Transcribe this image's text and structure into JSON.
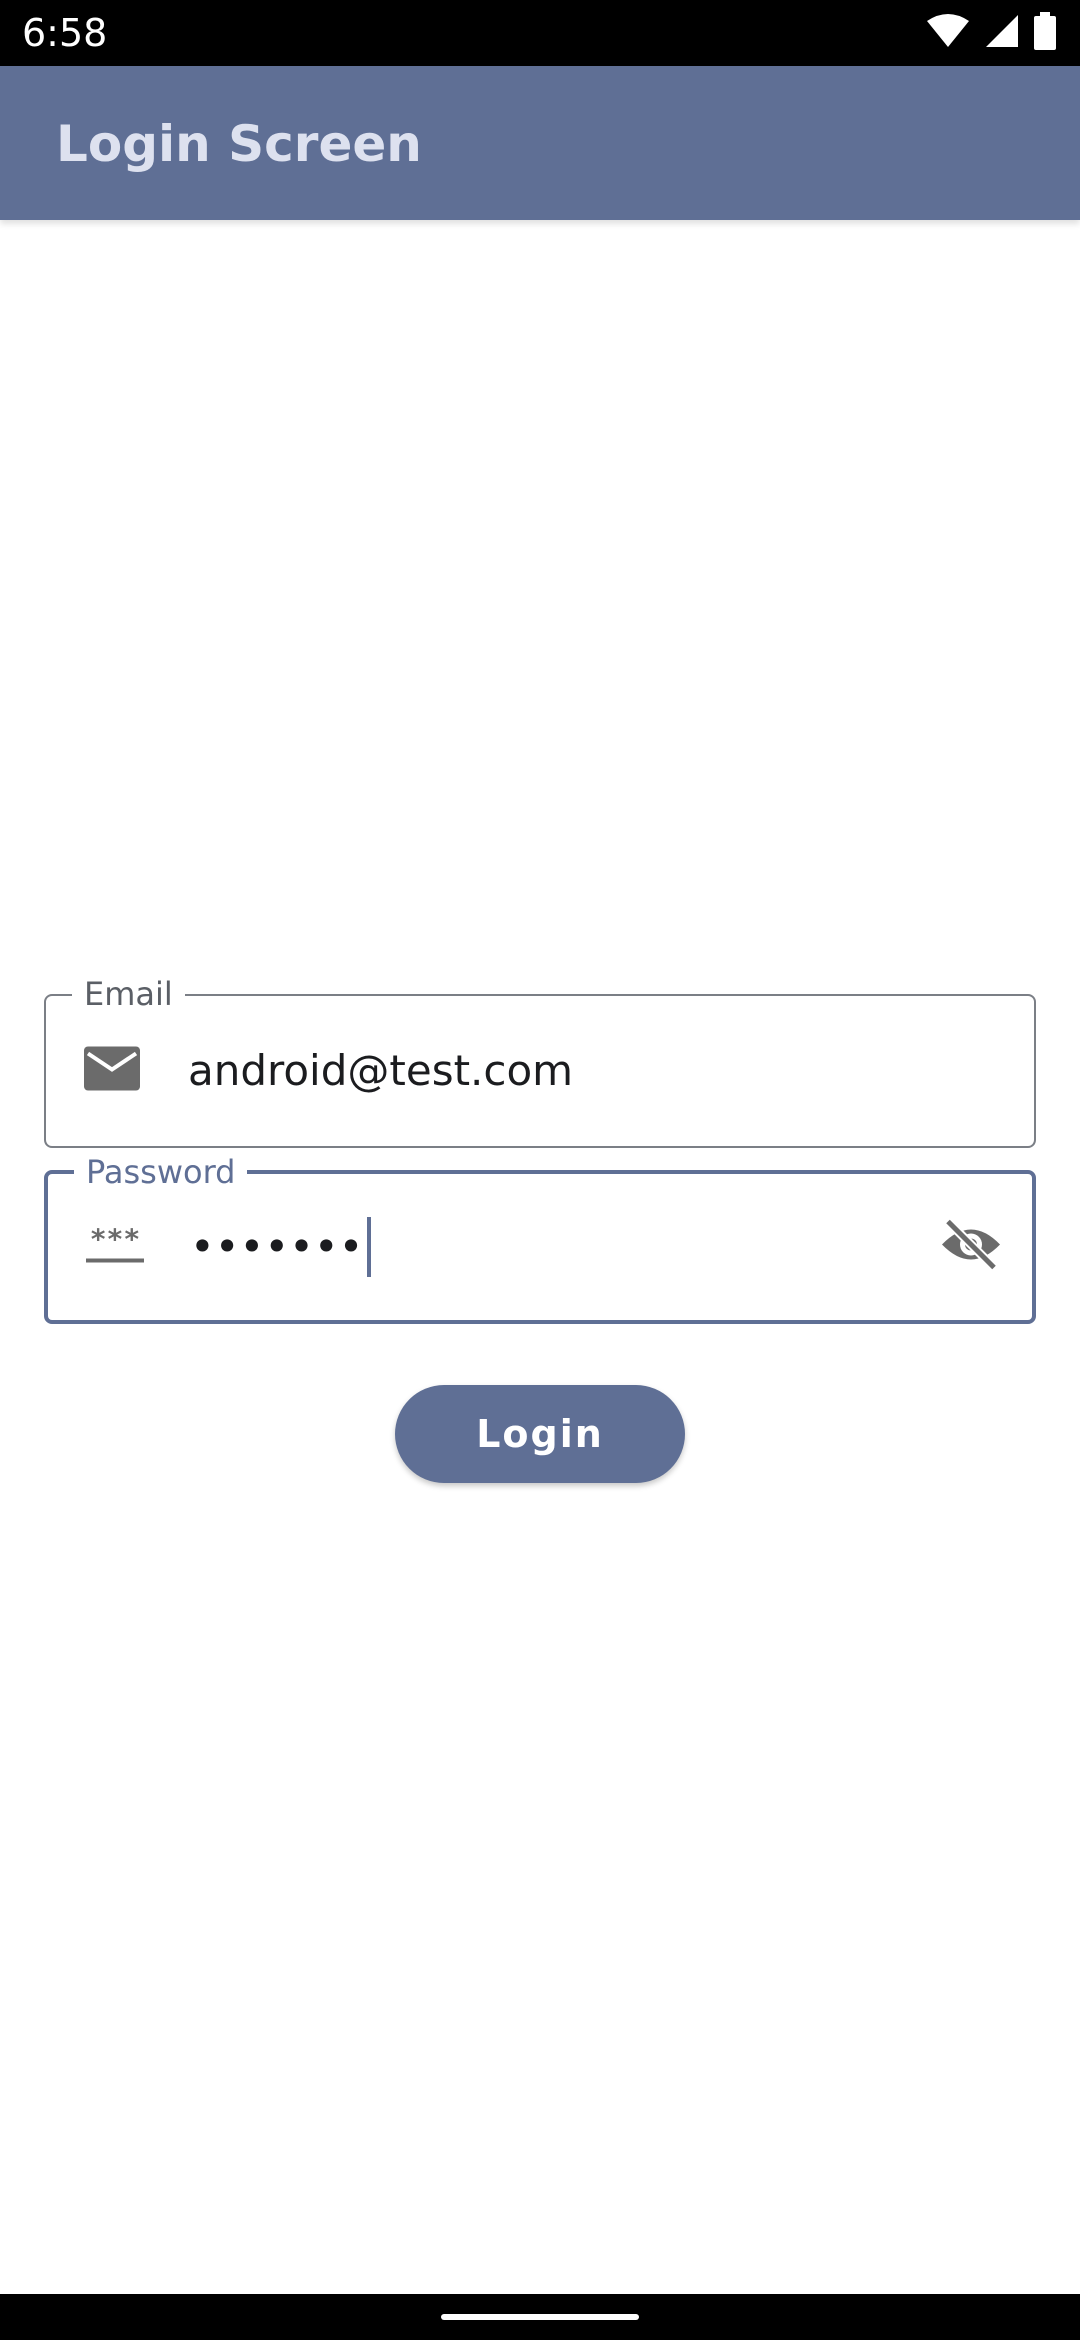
{
  "status_bar": {
    "time": "6:58",
    "icons": [
      "wifi-icon",
      "cellular-signal-icon",
      "battery-icon"
    ]
  },
  "app_bar": {
    "title": "Login Screen"
  },
  "form": {
    "email": {
      "label": "Email",
      "value": "android@test.com",
      "leading_icon": "email-envelope-icon"
    },
    "password": {
      "label": "Password",
      "value": "•••••••",
      "leading_icon": "password-icon",
      "trailing_icon": "visibility-off-icon"
    },
    "login_button": "Login"
  },
  "colors": {
    "primary": "#5f6f95",
    "app_bar_title": "#dde1ef",
    "outline": "#7b7f86",
    "icon": "#6b6b6b"
  }
}
